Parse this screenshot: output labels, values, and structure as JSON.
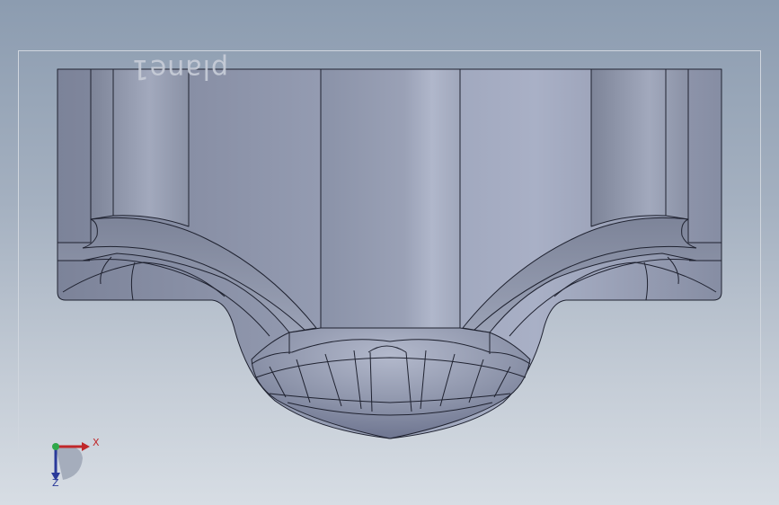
{
  "viewport": {
    "plane_label": "plane1",
    "colors": {
      "background_top": "#8c9cb0",
      "background_bottom": "#d7dde4",
      "model_face": "#8f97ab",
      "model_edge": "#1f2230",
      "plane_border": "#d0d6de"
    }
  },
  "triad": {
    "x_label": "X",
    "z_label": "Z",
    "x_color": "#c0282a",
    "y_color": "#2fa84a",
    "z_color": "#2a3a9a"
  }
}
